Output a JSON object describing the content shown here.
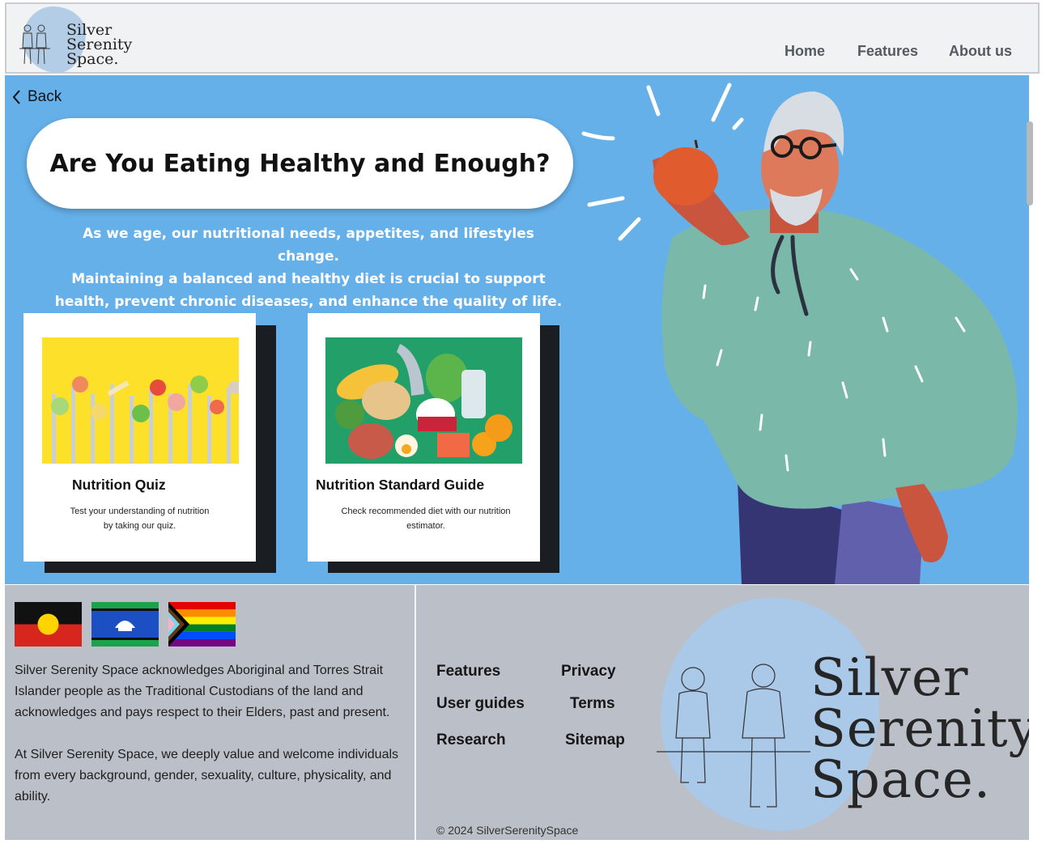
{
  "header": {
    "logo_lines": [
      "Silver",
      "Serenity",
      "Space."
    ],
    "nav": [
      "Home",
      "Features",
      "About us"
    ]
  },
  "hero": {
    "back_label": "Back",
    "title": "Are You Eating Healthy and Enough?",
    "intro_lines": [
      "As we age, our nutritional needs, appetites, and lifestyles change.",
      "Maintaining a balanced and healthy diet is crucial to support",
      "health, prevent chronic diseases, and enhance the quality of life."
    ],
    "cards": [
      {
        "title": "Nutrition Quiz",
        "desc_lines": [
          "Test your understanding of nutrition",
          "by taking our quiz."
        ]
      },
      {
        "title": "Nutrition Standard Guide",
        "desc_lines": [
          "Check recommended  diet with our nutrition",
          "estimator."
        ]
      }
    ]
  },
  "footer": {
    "ack_lines": [
      "Silver Serenity Space acknowledges Aboriginal and Torres Strait",
      "Islander people as the Traditional Custodians of the land  and",
      "acknowledges and pays respect to their Elders, past and present."
    ],
    "welcome_lines": [
      "At Silver Serenity Space, we deeply value and welcome individuals",
      "from every background, gender, sexuality, culture, physicality, and",
      "ability."
    ],
    "links": {
      "features": "Features",
      "privacy": "Privacy",
      "user_guides": "User guides",
      "terms": "Terms",
      "research": "Research",
      "sitemap": "Sitemap"
    },
    "copyright": "© 2024 SilverSerenitySpace",
    "logo_lines": [
      "Silver",
      "Serenity",
      "Space."
    ]
  },
  "colors": {
    "hero_bg": "#66b0ea",
    "footer_bg": "#bbbfc8",
    "header_bg": "#f1f2f4",
    "sweater": "#7ab9aa"
  }
}
